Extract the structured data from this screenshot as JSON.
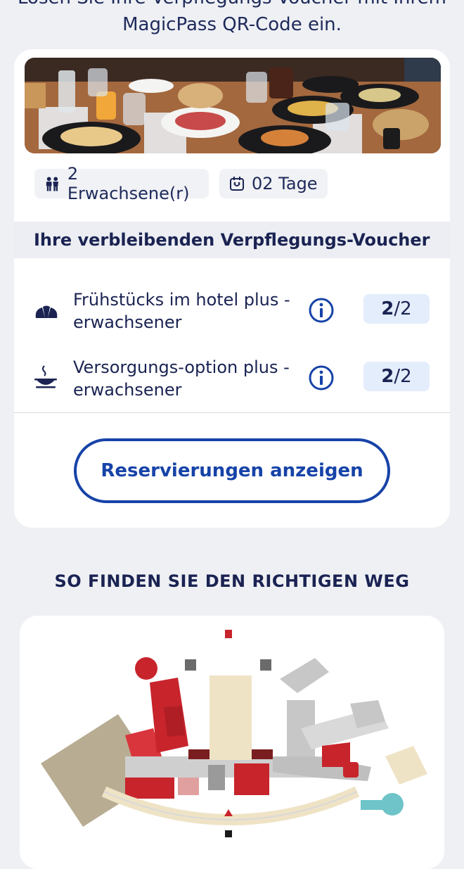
{
  "intro": {
    "line1": "Lösen Sie Ihre Verpflegungs-Voucher mit Ihrem",
    "line2": "MagicPass QR-Code ein."
  },
  "booking": {
    "guests": "2 Erwachsene(r)",
    "days": "02 Tage",
    "guests_icon": "people-icon",
    "days_icon": "calendar-icon"
  },
  "vouchers": {
    "title": "Ihre verbleibenden Verpflegungs-Voucher",
    "items": [
      {
        "label": "Frühstücks im hotel plus - erwachsener",
        "remaining": "2",
        "total": "/2",
        "icon": "croissant-icon"
      },
      {
        "label": "Versorgungs-option plus - erwachsener",
        "remaining": "2",
        "total": "/2",
        "icon": "hot-dish-icon"
      }
    ]
  },
  "reservations_button": "Reservierungen anzeigen",
  "wayfinding": {
    "title": "SO FINDEN SIE DEN RICHTIGEN WEG"
  },
  "colors": {
    "primary": "#1643a8",
    "text": "#1a2352",
    "badge_bg": "#e3edfb",
    "map_red": "#c8242c"
  }
}
